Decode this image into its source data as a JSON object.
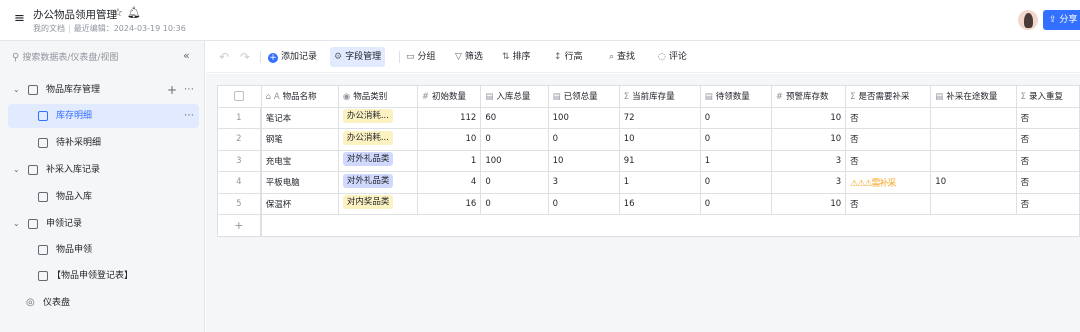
{
  "header": {
    "title": "办公物品领用管理",
    "star_icon": "star-icon",
    "bell_icon": "bell-icon",
    "location": "我的文档",
    "edited": "最近编辑：2024-03-19 10:36",
    "share_label": "分享"
  },
  "sidebar": {
    "search_placeholder": "搜索数据表/仪表盘/视图",
    "groups": [
      {
        "label": "物品库存管理",
        "children": [
          "库存明细",
          "待补采明细"
        ]
      },
      {
        "label": "补采入库记录",
        "children": [
          "物品入库"
        ]
      },
      {
        "label": "申领记录",
        "children": [
          "物品申领",
          "【物品申领登记表】"
        ]
      }
    ],
    "dashboard": "仪表盘"
  },
  "toolbar": {
    "add_record": "添加记录",
    "field_manage": "字段管理",
    "group": "分组",
    "filter": "筛选",
    "sort": "排序",
    "row_height": "行高",
    "find": "查找",
    "comment": "评论"
  },
  "table": {
    "columns": [
      "物品名称",
      "物品类别",
      "初始数量",
      "入库总量",
      "已领总量",
      "当前库存量",
      "待领数量",
      "预警库存数",
      "是否需要补采",
      "补采在途数量",
      "录入重复"
    ],
    "rows": [
      {
        "no": "1",
        "name": "笔记本",
        "category": "办公消耗...",
        "cat_color": "yellow",
        "init": "112",
        "in": "60",
        "out": "100",
        "stock": "72",
        "pending": "0",
        "warn": "10",
        "need": "否",
        "transit": "",
        "dup": "否"
      },
      {
        "no": "2",
        "name": "钢笔",
        "category": "办公消耗...",
        "cat_color": "yellow",
        "init": "10",
        "in": "0",
        "out": "0",
        "stock": "10",
        "pending": "0",
        "warn": "10",
        "need": "否",
        "transit": "",
        "dup": "否"
      },
      {
        "no": "3",
        "name": "充电宝",
        "category": "对外礼品类",
        "cat_color": "blue",
        "init": "1",
        "in": "100",
        "out": "10",
        "stock": "91",
        "pending": "1",
        "warn": "3",
        "need": "否",
        "transit": "",
        "dup": "否"
      },
      {
        "no": "4",
        "name": "平板电脑",
        "category": "对外礼品类",
        "cat_color": "blue",
        "init": "4",
        "in": "0",
        "out": "3",
        "stock": "1",
        "pending": "0",
        "warn": "3",
        "need": "⚠⚠⚠需补采",
        "transit": "10",
        "dup": "否"
      },
      {
        "no": "5",
        "name": "保温杯",
        "category": "对内奖品类",
        "cat_color": "yellow",
        "init": "16",
        "in": "0",
        "out": "0",
        "stock": "16",
        "pending": "0",
        "warn": "10",
        "need": "否",
        "transit": "",
        "dup": "否"
      }
    ]
  },
  "colors": {
    "accent": "#3370ff",
    "tag_yellow": "#fcf1c1",
    "tag_blue": "#d0d8fd"
  }
}
